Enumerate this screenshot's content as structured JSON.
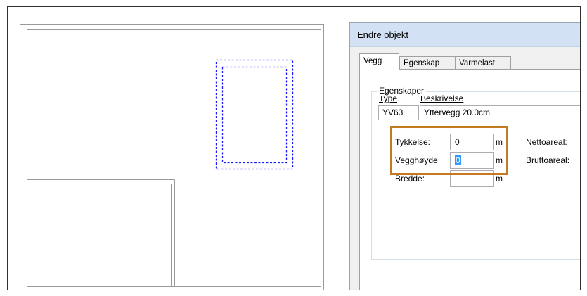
{
  "dialog": {
    "title": "Endre objekt",
    "tabs": [
      {
        "label": "Vegg",
        "active": true
      },
      {
        "label": "Egenskap",
        "active": false
      },
      {
        "label": "Varmelast",
        "active": false
      }
    ],
    "type_label": "Type",
    "type_value": "YV63",
    "beskrivelse_label": "Beskrivelse",
    "beskrivelse_value": "Yttervegg 20.0cm",
    "egenskaper_group": "Egenskaper",
    "tykkelse_label": "Tykkelse:",
    "tykkelse_value": "0",
    "vegghoyde_label": "Vegghøyde",
    "vegghoyde_value": "0",
    "bredde_label": "Bredde:",
    "bredde_value": "",
    "unit": "m",
    "nettoareal_label": "Nettoareal:",
    "bruttoareal_label": "Bruttoareal:"
  },
  "colors": {
    "highlight": "#c47a20",
    "selection_dashes": "#1a1aff",
    "titlebar": "#d2e1f3"
  }
}
